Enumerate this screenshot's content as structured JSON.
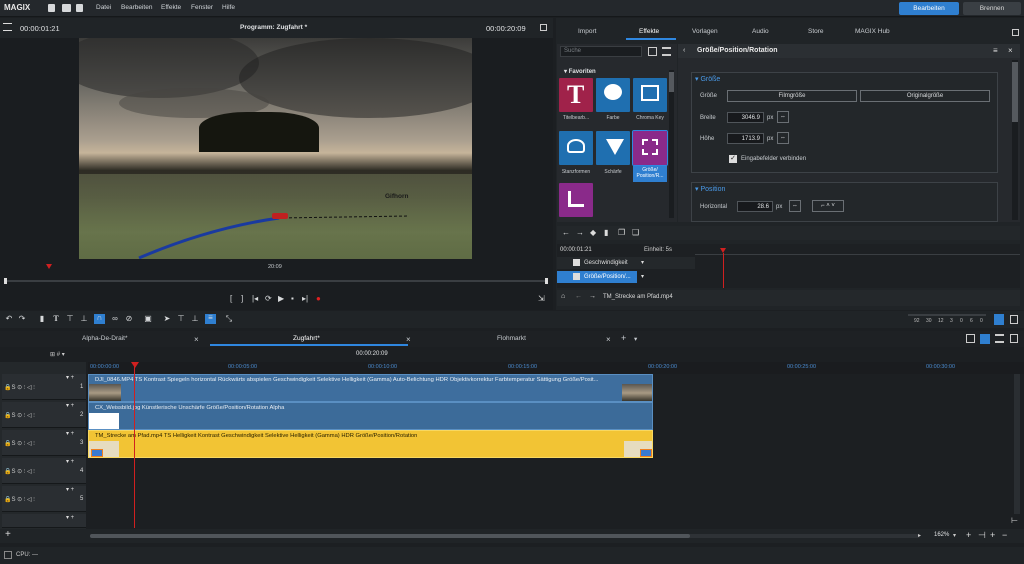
{
  "app": {
    "name": "MAGIX"
  },
  "menu": [
    "Datei",
    "Bearbeiten",
    "Effekte",
    "Fenster",
    "Hilfe"
  ],
  "mode_buttons": {
    "edit": "Bearbeiten",
    "burn": "Brennen"
  },
  "monitor": {
    "timecode_left": "00:00:01:21",
    "title": "Programm: Zugfahrt *",
    "timecode_right": "00:00:20:09",
    "scrub_time": "20:09",
    "video_text": "Gifhorn",
    "transport": [
      "[",
      "]",
      "|◂",
      "⟳",
      "▶",
      "▪",
      "▸|",
      "●"
    ]
  },
  "right_tabs": [
    "Import",
    "Effekte",
    "Vorlagen",
    "Audio",
    "Store",
    "MAGIX Hub"
  ],
  "fx": {
    "search_placeholder": "Suche",
    "category": "Favoriten",
    "tiles": [
      {
        "label": "Titelbearb..."
      },
      {
        "label": "Farbe"
      },
      {
        "label": "Chroma Key"
      },
      {
        "label": "Stanzformen"
      },
      {
        "label": "Schärfe"
      },
      {
        "label": "Größe/ Position/R..."
      }
    ]
  },
  "props": {
    "title": "Größe/Position/Rotation",
    "size_section": "Größe",
    "size_label": "Größe",
    "btn_film": "Filmgröße",
    "btn_orig": "Originalgröße",
    "width_label": "Breite",
    "width_value": "3046.9",
    "height_label": "Höhe",
    "height_value": "1713.9",
    "unit": "px",
    "link_label": "Eingabefelder verbinden",
    "position_section": "Position",
    "horiz_label": "Horizontal",
    "horiz_value": "28.6"
  },
  "keyframes": {
    "time": "00:00:01:21",
    "unit": "Einheit: 5s",
    "rows": [
      "Geschwindigkeit",
      "Größe/Position/..."
    ]
  },
  "object": {
    "name": "TM_Strecke am Pfad.mp4"
  },
  "meter": [
    "92",
    "30",
    "12",
    "3",
    "0",
    "6",
    "0"
  ],
  "timeline_tabs": [
    "Alpha-De-Drait*",
    "Zugfahrt*",
    "Flohmarkt"
  ],
  "timeline": {
    "position": "00:00:20:09",
    "ruler": [
      "00:00:00:00",
      "00:00:05:00",
      "00:00:10:00",
      "00:00:15:00",
      "00:00:20:00",
      "00:00:25:00",
      "00:00:30:00"
    ],
    "tracks": [
      "1",
      "2",
      "3",
      "4",
      "5"
    ],
    "clips": [
      {
        "title": "DJI_0846.MP4 TS   Kontrast  Spiegeln horizontal  Rückwärts abspielen  Geschwindigkeit  Selektive Helligkeit (Gamma)  Auto-Belichtung  HDR  Objektivkorrektur  Farbtemperatur  Sättigung  Größe/Posit..."
      },
      {
        "title": "CX_Weissbild.jpg   Künstlerische Unschärfe  Größe/Position/Rotation  Alpha"
      },
      {
        "title": "TM_Strecke am Pfad.mp4 TS   Helligkeit  Kontrast  Geschwindigkeit  Selektive Helligkeit (Gamma)  HDR  Größe/Position/Rotation"
      }
    ],
    "zoom": "162%"
  },
  "status": {
    "cpu": "CPU: —"
  },
  "colors": {
    "accent": "#2f7fd0",
    "clip_blue": "#3e6e9e",
    "clip_yellow": "#f2c434",
    "playhead": "#d02020"
  }
}
